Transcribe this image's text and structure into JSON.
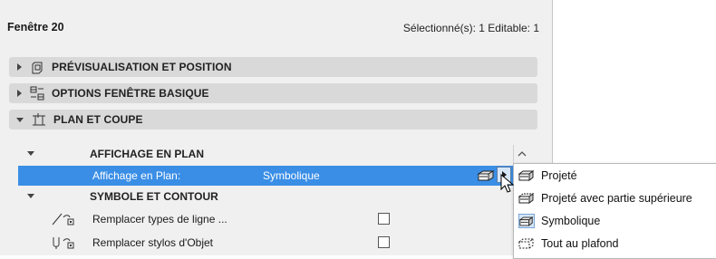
{
  "window": {
    "title": "Fenêtre 20",
    "selection_status": "Sélectionné(s): 1 Editable: 1"
  },
  "sections": [
    {
      "label": "PRÉVISUALISATION ET POSITION",
      "icon": "preview-position-icon",
      "expanded": false
    },
    {
      "label": "OPTIONS FENÊTRE BASIQUE",
      "icon": "window-options-icon",
      "expanded": false
    },
    {
      "label": "PLAN ET COUPE",
      "icon": "plan-section-icon",
      "expanded": true
    }
  ],
  "plan_display": {
    "heading": "AFFICHAGE EN PLAN",
    "row": {
      "label": "Affichage en Plan:",
      "value": "Symbolique",
      "icon": "symbolic-display-icon"
    }
  },
  "symbol_contour": {
    "heading": "SYMBOLE ET CONTOUR",
    "rows": [
      {
        "label": "Remplacer types de ligne ...",
        "icon": "override-linetype-icon",
        "checked": false
      },
      {
        "label": "Remplacer stylos d'Objet",
        "icon": "override-pen-icon",
        "checked": false
      }
    ]
  },
  "dropdown": {
    "options": [
      {
        "label": "Projeté",
        "icon": "projected-icon",
        "selected": false
      },
      {
        "label": "Projeté avec partie supérieure",
        "icon": "projected-overhead-icon",
        "selected": false
      },
      {
        "label": "Symbolique",
        "icon": "symbolic-icon",
        "selected": true
      },
      {
        "label": "Tout au plafond",
        "icon": "overhead-all-icon",
        "selected": false
      }
    ]
  },
  "colors": {
    "selection": "#3a8ee6",
    "section_bg": "#d9d9d9",
    "panel_bg": "#f0f0f0"
  }
}
